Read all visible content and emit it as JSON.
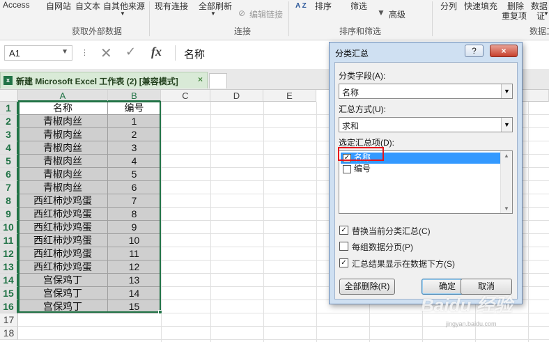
{
  "ribbon": {
    "items": [
      "Access",
      "自网站",
      "自文本",
      "自其他来源",
      "现有连接",
      "全部刷新",
      "编辑链接",
      "排序",
      "筛选",
      "高级",
      "分列",
      "快速填充",
      "删除",
      "重复项",
      "数据",
      "证"
    ],
    "groups": [
      "获取外部数据",
      "连接",
      "排序和筛选",
      "数据工"
    ],
    "sort_icon": "A Z"
  },
  "formula_bar": {
    "name_box": "A1",
    "cancel_symbol": "✕",
    "enter_symbol": "✓",
    "fx": "fx",
    "content": "名称"
  },
  "workbook": {
    "tab_title": "新建 Microsoft Excel 工作表 (2)  [兼容模式]",
    "close_symbol": "×",
    "icon_text": "x"
  },
  "sheet": {
    "columns": [
      "A",
      "B",
      "C",
      "D",
      "E"
    ],
    "rows": [
      "1",
      "2",
      "3",
      "4",
      "5",
      "6",
      "7",
      "8",
      "9",
      "10",
      "11",
      "12",
      "13",
      "14",
      "15",
      "16",
      "17",
      "18"
    ],
    "header": [
      "名称",
      "编号"
    ],
    "data": [
      [
        "青椒肉丝",
        "1"
      ],
      [
        "青椒肉丝",
        "2"
      ],
      [
        "青椒肉丝",
        "3"
      ],
      [
        "青椒肉丝",
        "4"
      ],
      [
        "青椒肉丝",
        "5"
      ],
      [
        "青椒肉丝",
        "6"
      ],
      [
        "西红柿炒鸡蛋",
        "7"
      ],
      [
        "西红柿炒鸡蛋",
        "8"
      ],
      [
        "西红柿炒鸡蛋",
        "9"
      ],
      [
        "西红柿炒鸡蛋",
        "10"
      ],
      [
        "西红柿炒鸡蛋",
        "11"
      ],
      [
        "西红柿炒鸡蛋",
        "12"
      ],
      [
        "宫保鸡丁",
        "13"
      ],
      [
        "宫保鸡丁",
        "14"
      ],
      [
        "宫保鸡丁",
        "15"
      ]
    ]
  },
  "dialog": {
    "title": "分类汇总",
    "help_symbol": "?",
    "close_symbol": "×",
    "group_by_label": "分类字段(A):",
    "group_by_value": "名称",
    "function_label": "汇总方式(U):",
    "function_value": "求和",
    "subtotal_label": "选定汇总项(D):",
    "subtotal_items": [
      {
        "label": "名称",
        "checked": "✓"
      },
      {
        "label": "编号",
        "checked": ""
      }
    ],
    "opt_replace": "替换当前分类汇总(C)",
    "opt_pagebreak": "每组数据分页(P)",
    "opt_summary_below": "汇总结果显示在数据下方(S)",
    "check_mark": "✓",
    "remove_all": "全部删除(R)",
    "ok": "确定",
    "cancel": "取消"
  },
  "watermark": {
    "main": "Baidu 经验",
    "sub": "jingyan.baidu.com"
  }
}
